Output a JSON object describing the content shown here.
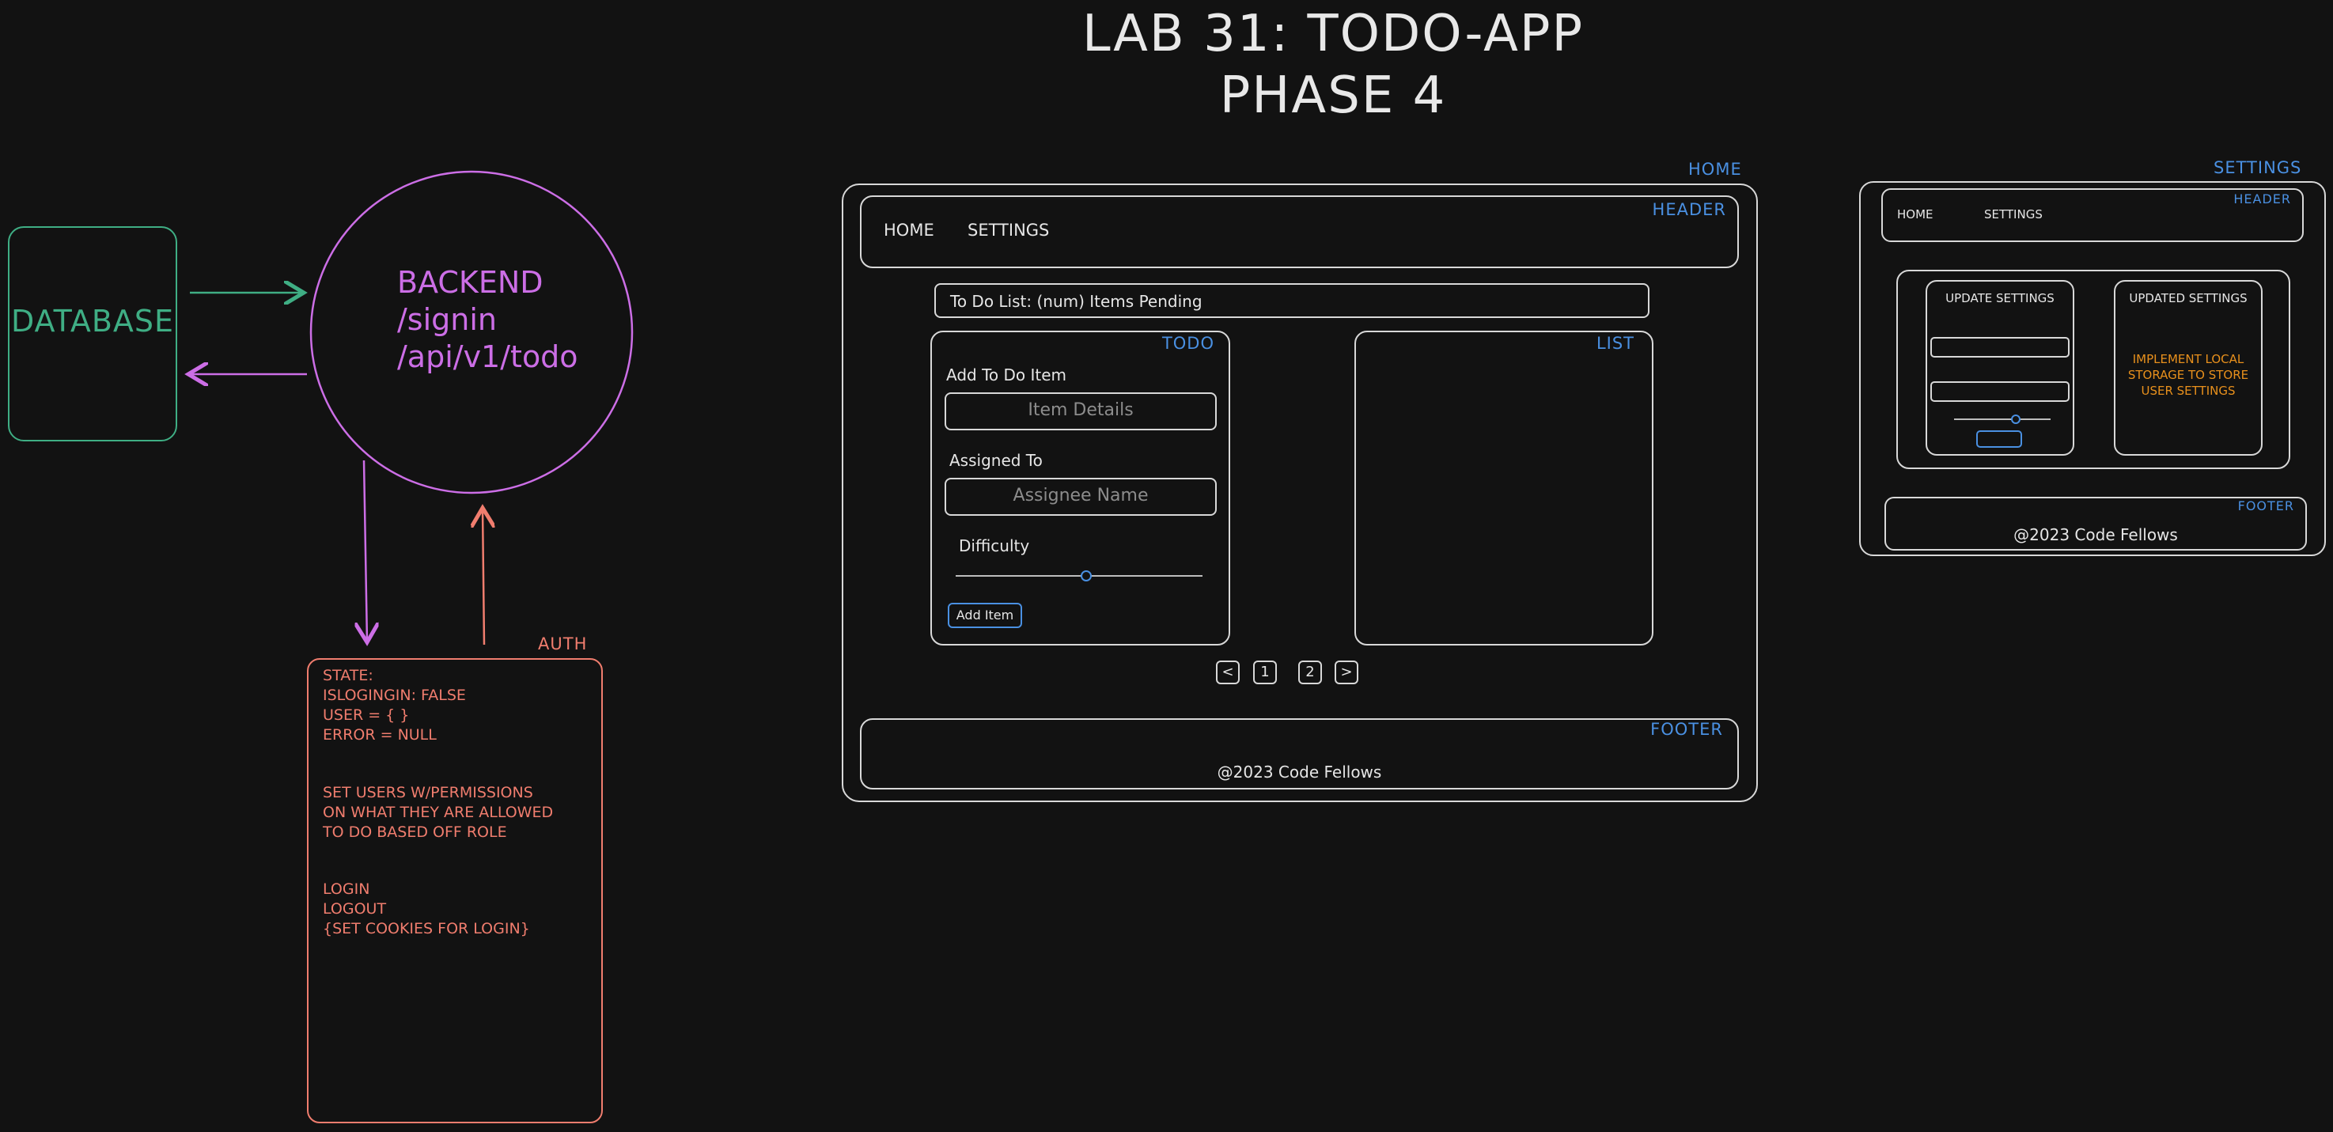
{
  "title": {
    "line1": "LAB 31: TODO-APP",
    "line2": "PHASE 4"
  },
  "database": {
    "label": "DATABASE"
  },
  "backend": {
    "line1": "BACKEND",
    "line2": "/signin",
    "line3": "/api/v1/todo"
  },
  "auth": {
    "tag": "AUTH",
    "lines1": [
      "STATE:",
      "ISLOGINGIN: FALSE",
      "USER = { }",
      "ERROR = NULL"
    ],
    "lines2": [
      "SET USERS W/PERMISSIONS",
      "ON WHAT THEY ARE ALLOWED",
      "TO DO BASED OFF ROLE"
    ],
    "lines3": [
      "LOGIN",
      "LOGOUT",
      "{SET COOKIES FOR LOGIN}"
    ]
  },
  "home": {
    "tag": "HOME",
    "header_tag": "HEADER",
    "nav_home": "HOME",
    "nav_settings": "SETTINGS",
    "status": "To Do List: (num) Items Pending",
    "todo_tag": "TODO",
    "add_label": "Add To Do Item",
    "item_placeholder": "Item Details",
    "assigned_label": "Assigned To",
    "assignee_placeholder": "Assignee Name",
    "difficulty_label": "Difficulty",
    "add_button": "Add Item",
    "list_tag": "LIST",
    "pager_prev": "<",
    "pager_1": "1",
    "pager_2": "2",
    "pager_next": ">",
    "footer_tag": "FOOTER",
    "footer_text": "@2023 Code Fellows"
  },
  "settings": {
    "tag": "SETTINGS",
    "header_tag": "HEADER",
    "nav_home": "HOME",
    "nav_settings": "SETTINGS",
    "update_title": "UPDATE SETTINGS",
    "updated_title": "UPDATED SETTINGS",
    "note_lines": [
      "IMPLEMENT LOCAL",
      "STORAGE TO STORE",
      "USER SETTINGS"
    ],
    "footer_tag": "FOOTER",
    "footer_text": "@2023 Code Fellows"
  },
  "colors": {
    "green": "#3fae84",
    "purple": "#cc6ee6",
    "salmon": "#f07d6e",
    "blue": "#4a90e2",
    "orange": "#e8901c",
    "line": "#d8d8d8"
  }
}
